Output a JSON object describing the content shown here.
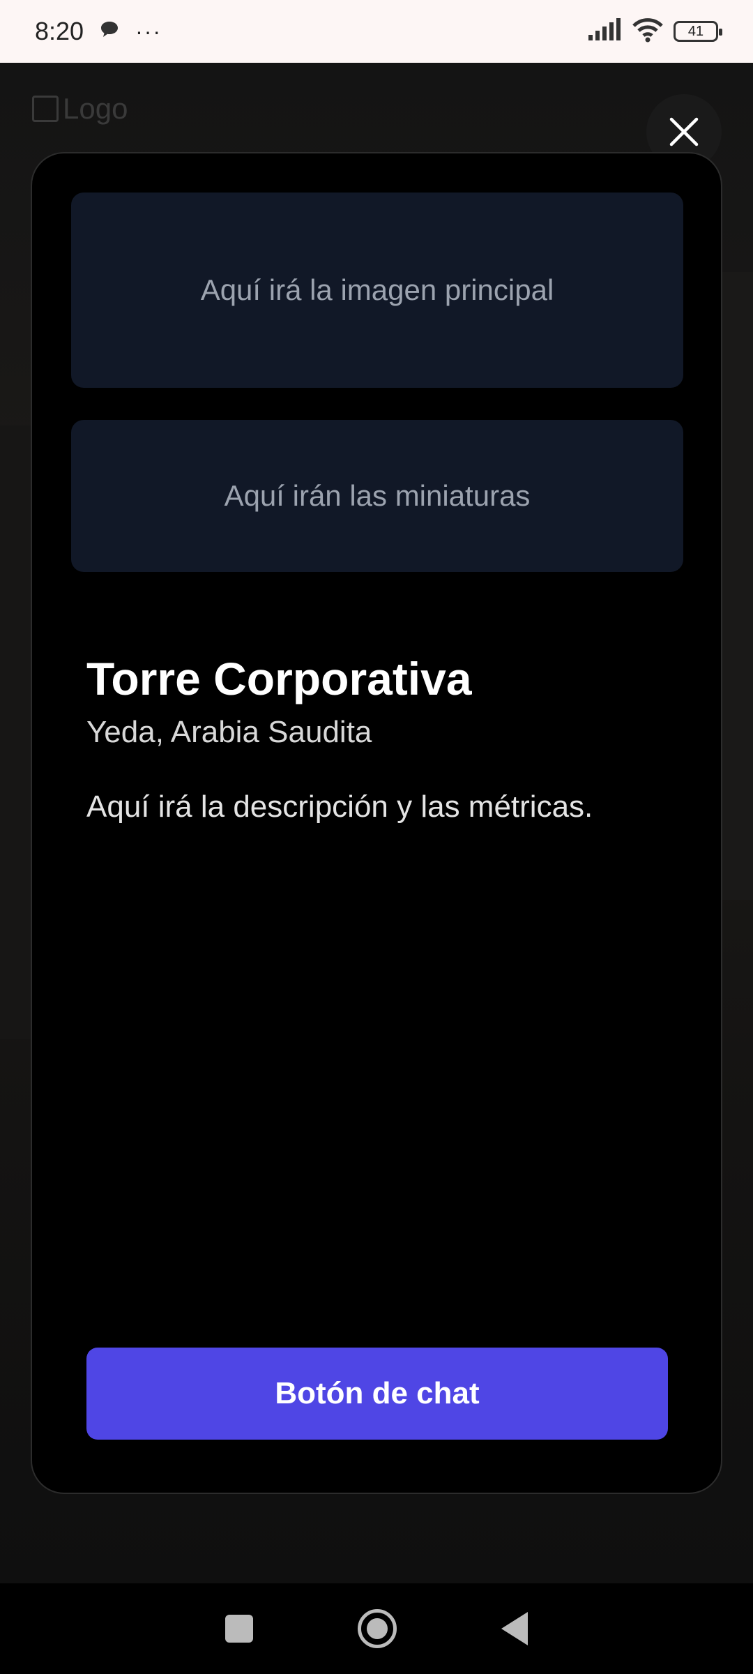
{
  "status_bar": {
    "time": "8:20",
    "ellipsis": "···",
    "battery": "41"
  },
  "background": {
    "logo_alt": "Logo"
  },
  "modal": {
    "main_image_placeholder": "Aquí irá la imagen principal",
    "thumbnails_placeholder": "Aquí irán las miniaturas",
    "title": "Torre Corporativa",
    "location": "Yeda, Arabia Saudita",
    "description": "Aquí irá la descripción y las métricas.",
    "chat_button": "Botón de chat"
  },
  "colors": {
    "accent": "#4f46e5",
    "placeholder_bg": "#111827",
    "placeholder_text": "#9ca3af"
  },
  "icons": [
    "chat-bubble-icon",
    "signal-icon",
    "wifi-icon",
    "battery-icon",
    "close-icon",
    "recents-icon",
    "home-icon",
    "back-icon"
  ]
}
